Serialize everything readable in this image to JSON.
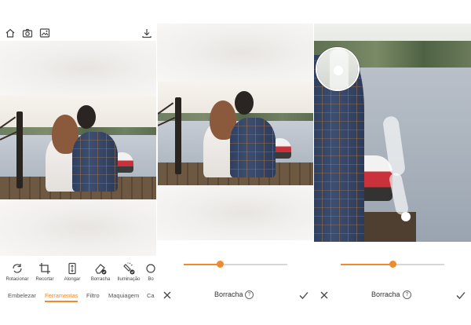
{
  "toolbar": {
    "tools": [
      {
        "label": "Rotacionar",
        "icon": "rotate-icon"
      },
      {
        "label": "Recortar",
        "icon": "crop-icon"
      },
      {
        "label": "Alongar",
        "icon": "stretch-icon"
      },
      {
        "label": "Borracha",
        "icon": "eraser-icon"
      },
      {
        "label": "Iluminação",
        "icon": "lighting-icon"
      },
      {
        "label": "Bo",
        "icon": "tool-icon"
      }
    ]
  },
  "tabs": [
    {
      "label": "Embelezar"
    },
    {
      "label": "Ferramentas",
      "active": true
    },
    {
      "label": "Filtro"
    },
    {
      "label": "Maquiagem"
    },
    {
      "label": "Ca"
    }
  ],
  "eraser_screen": {
    "title": "Borracha",
    "help_symbol": "?",
    "slider_value": 0.35
  },
  "eraser_zoom_screen": {
    "title": "Borracha",
    "help_symbol": "?",
    "slider_value": 0.5
  },
  "colors": {
    "accent": "#f08a2e"
  }
}
